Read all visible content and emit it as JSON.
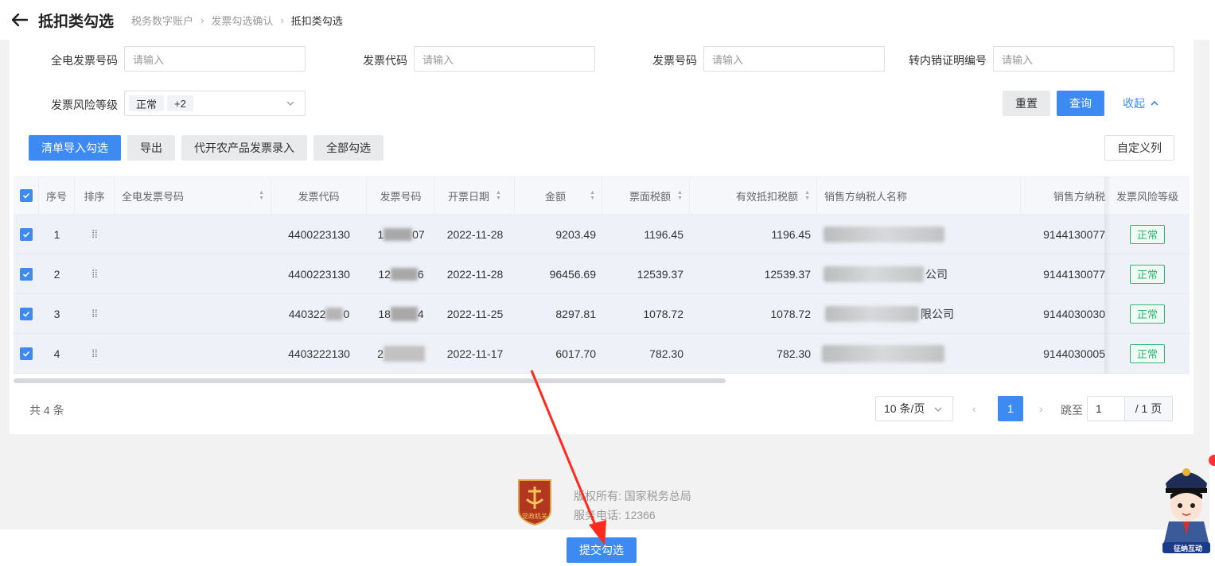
{
  "header": {
    "title": "抵扣类勾选",
    "breadcrumb": [
      "税务数字账户",
      "发票勾选确认",
      "抵扣类勾选"
    ]
  },
  "filters": {
    "full_invoice_no": {
      "label": "全电发票号码",
      "placeholder": "请输入"
    },
    "invoice_code": {
      "label": "发票代码",
      "placeholder": "请输入"
    },
    "invoice_no": {
      "label": "发票号码",
      "placeholder": "请输入"
    },
    "transfer_cert_no": {
      "label": "转内销证明编号",
      "placeholder": "请输入"
    },
    "risk_level": {
      "label": "发票风险等级",
      "selected_tag": "正常",
      "more_tag": "+2"
    }
  },
  "actions": {
    "reset": "重置",
    "query": "查询",
    "collapse": "收起",
    "import_select": "清单导入勾选",
    "export": "导出",
    "agri_entry": "代开农产品发票录入",
    "select_all": "全部勾选",
    "custom_columns": "自定义列"
  },
  "table": {
    "columns": {
      "seq": "序号",
      "order": "排序",
      "full_no": "全电发票号码",
      "code": "发票代码",
      "number": "发票号码",
      "date": "开票日期",
      "amount": "金额",
      "tax": "票面税额",
      "valid_tax": "有效抵扣税额",
      "seller_name": "销售方纳税人名称",
      "seller_id": "销售方纳税",
      "risk": "发票风险等级"
    },
    "rows": [
      {
        "seq": "1",
        "code": "4400223130",
        "number_pre": "1",
        "number_post": "07",
        "date": "2022-11-28",
        "amount": "9203.49",
        "tax": "1196.45",
        "valid_tax": "1196.45",
        "seller_suffix": "",
        "seller_id": "9144130077",
        "risk": "正常"
      },
      {
        "seq": "2",
        "code": "4400223130",
        "number_pre": "12",
        "number_post": "6",
        "date": "2022-11-28",
        "amount": "96456.69",
        "tax": "12539.37",
        "valid_tax": "12539.37",
        "seller_suffix": "公司",
        "seller_id": "9144130077",
        "risk": "正常"
      },
      {
        "seq": "3",
        "code": "440322",
        "code_post": "0",
        "number_pre": "18",
        "number_post": "4",
        "date": "2022-11-25",
        "amount": "8297.81",
        "tax": "1078.72",
        "valid_tax": "1078.72",
        "seller_suffix": "限公司",
        "seller_id": "9144030030",
        "risk": "正常"
      },
      {
        "seq": "4",
        "code": "4403222130",
        "number_pre": "2",
        "number_post": "",
        "date": "2022-11-17",
        "amount": "6017.70",
        "tax": "782.30",
        "valid_tax": "782.30",
        "seller_suffix": "",
        "seller_id": "9144030005",
        "risk": "正常"
      }
    ]
  },
  "pagination": {
    "total": "共 4 条",
    "page_size": "10 条/页",
    "current_page": "1",
    "jump_label": "跳至",
    "jump_value": "1",
    "total_pages": "/ 1 页"
  },
  "footer": {
    "copyright": "版权所有: 国家税务总局",
    "hotline": "服务电话: 12366",
    "emblem_text": "党政机关"
  },
  "submit": "提交勾选",
  "assistant_label": "征纳互动",
  "colors": {
    "primary": "#3d8bf2",
    "success": "#2eb872",
    "annotation": "#ff2a1f"
  }
}
